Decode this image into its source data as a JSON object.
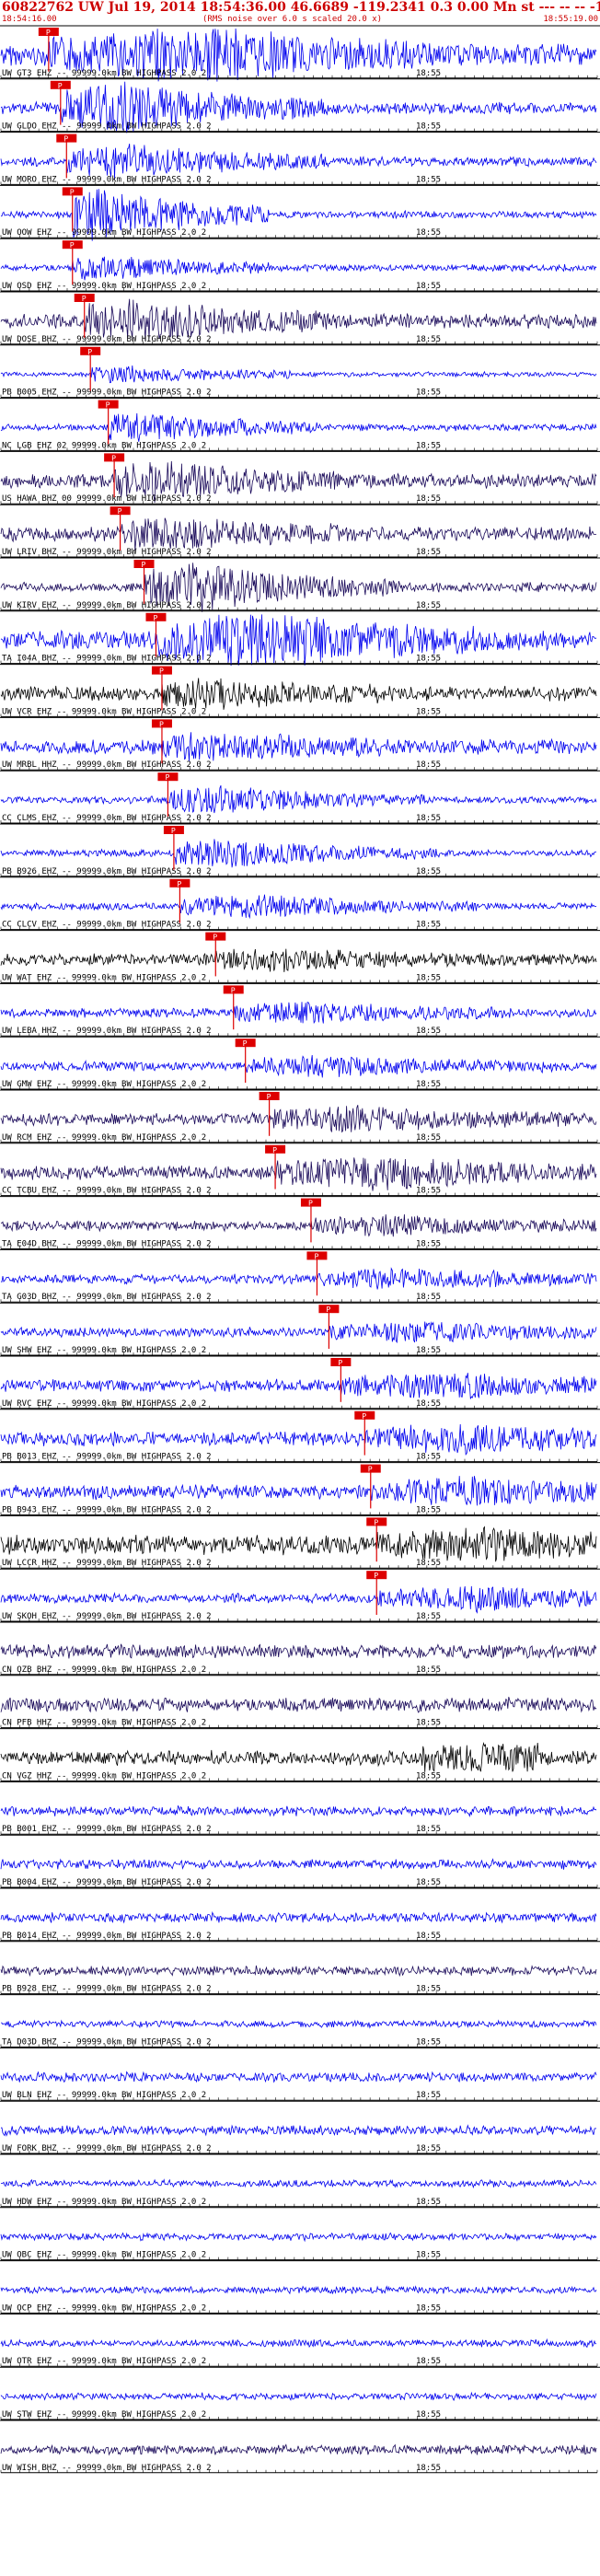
{
  "header": {
    "title": "60822762 UW Jul 19, 2014 18:54:36.00   46.6689 -119.2341  0.3 0.00 Mn st --- -- --  -1",
    "start_time": "18:54:16.00",
    "note": "(RMS noise over 6.0 s scaled 20.0 x)",
    "end_time": "18:55:19.00"
  },
  "colors": {
    "black": "#000000",
    "blue": "#0000ee",
    "navy": "#1a0a5a",
    "red": "#dd0000"
  },
  "chart_data": {
    "type": "line",
    "x_range": [
      "18:54:16.00",
      "18:55:19.00"
    ],
    "mid_tick_label": "18:55",
    "channels": [
      {
        "label": "UW GT3 EHZ -- 99999.0km BW  HIGHPASS  2.0  2",
        "color": "blue",
        "pick": "P",
        "amp": 0.45,
        "burst": 1.0,
        "burst_x": 0.55
      },
      {
        "label": "UW GLDO EHZ -- 99999.0km BW  HIGHPASS  2.0  2",
        "color": "blue",
        "pick": "P",
        "amp": 0.25,
        "burst": 0.9,
        "burst_x": 0.3
      },
      {
        "label": "UW MORO EHZ -- 99999.0km BW  HIGHPASS  2.0  2",
        "color": "blue",
        "pick": "P",
        "amp": 0.2,
        "burst": 0.6,
        "burst_x": 0.3
      },
      {
        "label": "UW OOW EHZ -- 99999.0km BW  HIGHPASS  2.0  2",
        "color": "blue",
        "pick": "P",
        "amp": 0.15,
        "burst": 1.0,
        "burst_x": 0.2
      },
      {
        "label": "UW OSD EHZ -- 99999.0km BW  HIGHPASS  2.0  2",
        "color": "blue",
        "pick": "P",
        "amp": 0.15,
        "burst": 0.4,
        "burst_x": 0.2
      },
      {
        "label": "UW DOSE BHZ -- 99999.0km BW  HIGHPASS  2.0  2",
        "color": "navy",
        "pick": "P",
        "amp": 0.3,
        "burst": 0.7,
        "burst_x": 0.3
      },
      {
        "label": "PB B005 EHZ -- 99999.0km BW  HIGHPASS  2.0  2",
        "color": "blue",
        "pick": "P",
        "amp": 0.1,
        "burst": 0.3,
        "burst_x": 0.25
      },
      {
        "label": "NC LGB EHZ 02 99999.0km BW  HIGHPASS  2.0  2",
        "color": "blue",
        "pick": "P",
        "amp": 0.15,
        "burst": 0.5,
        "burst_x": 0.28
      },
      {
        "label": "US HAWA BHZ 00 99999.0km BW  HIGHPASS  2.0  2",
        "color": "navy",
        "pick": "P",
        "amp": 0.3,
        "burst": 0.6,
        "burst_x": 0.32
      },
      {
        "label": "UW LRIV BHZ -- 99999.0km BW  HIGHPASS  2.0  2",
        "color": "navy",
        "pick": "P",
        "amp": 0.3,
        "burst": 0.5,
        "burst_x": 0.35
      },
      {
        "label": "UW KIRV EHZ -- 99999.0km BW  HIGHPASS  2.0  2",
        "color": "navy",
        "pick": "P",
        "amp": 0.2,
        "burst": 0.9,
        "burst_x": 0.42
      },
      {
        "label": "TA I04A BHZ -- 99999.0km BW  HIGHPASS  2.0  2",
        "color": "blue",
        "pick": "P",
        "amp": 0.4,
        "burst": 1.0,
        "burst_x": 0.6
      },
      {
        "label": "UW VCR EHZ -- 99999.0km BW  HIGHPASS  2.0  2",
        "color": "black",
        "pick": "P",
        "amp": 0.3,
        "burst": 0.4,
        "burst_x": 0.42
      },
      {
        "label": "UW MRBL HHZ -- 99999.0km BW  HIGHPASS  2.0  2",
        "color": "blue",
        "pick": "P",
        "amp": 0.3,
        "burst": 0.4,
        "burst_x": 0.44
      },
      {
        "label": "CC CLMS EHZ -- 99999.0km BW  HIGHPASS  2.0  2",
        "color": "blue",
        "pick": "P",
        "amp": 0.15,
        "burst": 0.5,
        "burst_x": 0.46
      },
      {
        "label": "PB B926 EHZ -- 99999.0km BW  HIGHPASS  2.0  2",
        "color": "blue",
        "pick": "P",
        "amp": 0.15,
        "burst": 0.5,
        "burst_x": 0.48
      },
      {
        "label": "CC CLCV EHZ -- 99999.0km BW  HIGHPASS  2.0  2",
        "color": "blue",
        "pick": "P",
        "amp": 0.15,
        "burst": 0.4,
        "burst_x": 0.55
      },
      {
        "label": "UW WAT EHZ -- 99999.0km BW  HIGHPASS  2.0  2",
        "color": "black",
        "pick": "P",
        "amp": 0.25,
        "burst": 0.3,
        "burst_x": 0.6
      },
      {
        "label": "UW LEBA HHZ -- 99999.0km BW  HIGHPASS  2.0  2",
        "color": "blue",
        "pick": "P",
        "amp": 0.2,
        "burst": 0.3,
        "burst_x": 0.62
      },
      {
        "label": "UW GMW EHZ -- 99999.0km BW  HIGHPASS  2.0  2",
        "color": "blue",
        "pick": "P",
        "amp": 0.2,
        "burst": 0.3,
        "burst_x": 0.68
      },
      {
        "label": "UW RCM EHZ -- 99999.0km BW  HIGHPASS  2.0  2",
        "color": "navy",
        "pick": "P",
        "amp": 0.25,
        "burst": 0.4,
        "burst_x": 0.72
      },
      {
        "label": "CC TCBU EHZ -- 99999.0km BW  HIGHPASS  2.0  2",
        "color": "navy",
        "pick": "P",
        "amp": 0.3,
        "burst": 0.5,
        "burst_x": 0.78
      },
      {
        "label": "TA E04D BHZ -- 99999.0km BW  HIGHPASS  2.0  2",
        "color": "navy",
        "pick": "P",
        "amp": 0.2,
        "burst": 0.3,
        "burst_x": 0.8
      },
      {
        "label": "TA G03D BHZ -- 99999.0km BW  HIGHPASS  2.0  2",
        "color": "blue",
        "pick": "P",
        "amp": 0.2,
        "burst": 0.3,
        "burst_x": 0.82
      },
      {
        "label": "UW SHW EHZ -- 99999.0km BW  HIGHPASS  2.0  2",
        "color": "blue",
        "pick": "P",
        "amp": 0.2,
        "burst": 0.3,
        "burst_x": 0.85
      },
      {
        "label": "UW RVC EHZ -- 99999.0km BW  HIGHPASS  2.0  2",
        "color": "blue",
        "pick": "P",
        "amp": 0.25,
        "burst": 0.4,
        "burst_x": 0.92
      },
      {
        "label": "PB B013 EHZ -- 99999.0km BW  HIGHPASS  2.0  2",
        "color": "blue",
        "pick": "P",
        "amp": 0.3,
        "burst": 0.4,
        "burst_x": 0.94
      },
      {
        "label": "PB B943 EHZ -- 99999.0km BW  HIGHPASS  2.0  2",
        "color": "blue",
        "pick": "P",
        "amp": 0.3,
        "burst": 0.4,
        "burst_x": 0.95
      },
      {
        "label": "UW LCCR HHZ -- 99999.0km BW  HIGHPASS  2.0  2",
        "color": "black",
        "pick": "P",
        "amp": 0.4,
        "burst": 0.4,
        "burst_x": 0.95
      },
      {
        "label": "UW SKOH EHZ -- 99999.0km BW  HIGHPASS  2.0  2",
        "color": "blue",
        "pick": "P",
        "amp": 0.2,
        "burst": 0.4,
        "burst_x": 0.96
      },
      {
        "label": "CN OZB BHZ -- 99999.0km BW  HIGHPASS  2.0  2",
        "color": "navy",
        "pick": "",
        "amp": 0.3,
        "burst": 0,
        "burst_x": 0
      },
      {
        "label": "CN PFB HHZ -- 99999.0km BW  HIGHPASS  2.0  2",
        "color": "navy",
        "pick": "",
        "amp": 0.3,
        "burst": 0,
        "burst_x": 0
      },
      {
        "label": "CN VGZ HHZ -- 99999.0km BW  HIGHPASS  2.0  2",
        "color": "black",
        "pick": "",
        "amp": 0.3,
        "burst": 0.5,
        "burst_x": 0.8
      },
      {
        "label": "PB B001 EHZ -- 99999.0km BW  HIGHPASS  2.0  2",
        "color": "blue",
        "pick": "",
        "amp": 0.2,
        "burst": 0,
        "burst_x": 0
      },
      {
        "label": "PB B004 EHZ -- 99999.0km BW  HIGHPASS  2.0  2",
        "color": "blue",
        "pick": "",
        "amp": 0.2,
        "burst": 0,
        "burst_x": 0
      },
      {
        "label": "PB B014 EHZ -- 99999.0km BW  HIGHPASS  2.0  2",
        "color": "blue",
        "pick": "",
        "amp": 0.2,
        "burst": 0,
        "burst_x": 0
      },
      {
        "label": "PB B928 EHZ -- 99999.0km BW  HIGHPASS  2.0  2",
        "color": "navy",
        "pick": "",
        "amp": 0.2,
        "burst": 0,
        "burst_x": 0
      },
      {
        "label": "TA D03D BHZ -- 99999.0km BW  HIGHPASS  2.0  2",
        "color": "blue",
        "pick": "",
        "amp": 0.15,
        "burst": 0,
        "burst_x": 0
      },
      {
        "label": "UW BLN EHZ -- 99999.0km BW  HIGHPASS  2.0  2",
        "color": "blue",
        "pick": "",
        "amp": 0.2,
        "burst": 0,
        "burst_x": 0
      },
      {
        "label": "UW FORK BHZ -- 99999.0km BW  HIGHPASS  2.0  2",
        "color": "blue",
        "pick": "",
        "amp": 0.2,
        "burst": 0,
        "burst_x": 0
      },
      {
        "label": "UW HDW EHZ -- 99999.0km BW  HIGHPASS  2.0  2",
        "color": "blue",
        "pick": "",
        "amp": 0.15,
        "burst": 0,
        "burst_x": 0
      },
      {
        "label": "UW OBC EHZ -- 99999.0km BW  HIGHPASS  2.0  2",
        "color": "blue",
        "pick": "",
        "amp": 0.15,
        "burst": 0,
        "burst_x": 0
      },
      {
        "label": "UW OCP EHZ -- 99999.0km BW  HIGHPASS  2.0  2",
        "color": "blue",
        "pick": "",
        "amp": 0.15,
        "burst": 0,
        "burst_x": 0
      },
      {
        "label": "UW OTR EHZ -- 99999.0km BW  HIGHPASS  2.0  2",
        "color": "blue",
        "pick": "",
        "amp": 0.15,
        "burst": 0,
        "burst_x": 0
      },
      {
        "label": "UW STW EHZ -- 99999.0km BW  HIGHPASS  2.0  2",
        "color": "blue",
        "pick": "",
        "amp": 0.15,
        "burst": 0,
        "burst_x": 0
      },
      {
        "label": "UW WISH BHZ -- 99999.0km BW  HIGHPASS  2.0  2",
        "color": "navy",
        "pick": "",
        "amp": 0.2,
        "burst": 0,
        "burst_x": 0
      }
    ],
    "pick_positions": [
      0.08,
      0.1,
      0.11,
      0.12,
      0.12,
      0.14,
      0.15,
      0.18,
      0.19,
      0.2,
      0.24,
      0.26,
      0.27,
      0.27,
      0.28,
      0.29,
      0.3,
      0.36,
      0.39,
      0.41,
      0.45,
      0.46,
      0.52,
      0.53,
      0.55,
      0.57,
      0.61,
      0.62,
      0.63,
      0.63
    ]
  }
}
